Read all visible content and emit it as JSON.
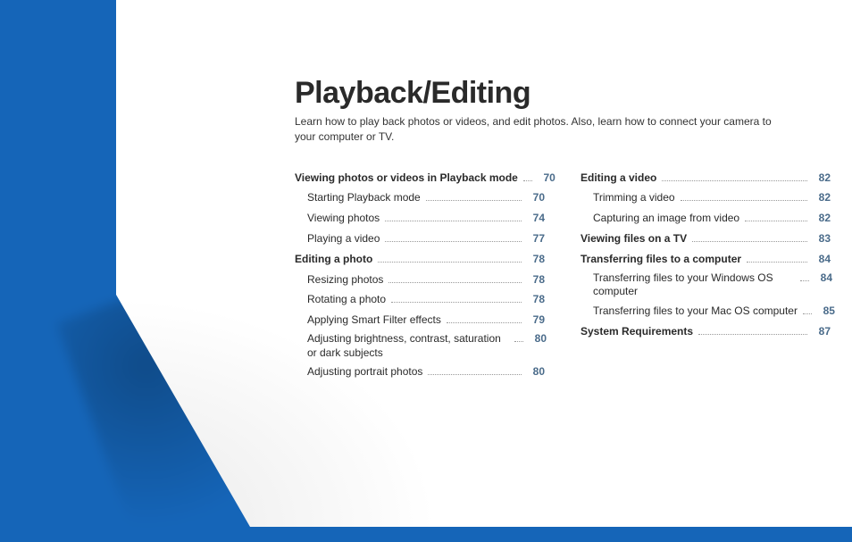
{
  "title": "Playback/Editing",
  "subtitle": "Learn how to play back photos or videos, and edit photos. Also, learn how to connect your camera to your computer or TV.",
  "col1": [
    {
      "label": "Viewing photos or videos in Playback mode",
      "page": "70",
      "type": "section",
      "dots": "…"
    },
    {
      "label": "Starting Playback mode",
      "page": "70",
      "type": "sub"
    },
    {
      "label": "Viewing photos",
      "page": "74",
      "type": "sub"
    },
    {
      "label": "Playing a video",
      "page": "77",
      "type": "sub"
    },
    {
      "label": "Editing a photo",
      "page": "78",
      "type": "section"
    },
    {
      "label": "Resizing photos",
      "page": "78",
      "type": "sub"
    },
    {
      "label": "Rotating a photo",
      "page": "78",
      "type": "sub"
    },
    {
      "label": "Applying Smart Filter effects",
      "page": "79",
      "type": "sub"
    },
    {
      "label": "Adjusting brightness, contrast, saturation or dark subjects",
      "page": "80",
      "type": "wrap"
    },
    {
      "label": "Adjusting portrait photos",
      "page": "80",
      "type": "sub"
    }
  ],
  "col2": [
    {
      "label": "Editing a video",
      "page": "82",
      "type": "section"
    },
    {
      "label": "Trimming a video",
      "page": "82",
      "type": "sub"
    },
    {
      "label": "Capturing an image from video",
      "page": "82",
      "type": "sub"
    },
    {
      "label": "Viewing files on a TV",
      "page": "83",
      "type": "section"
    },
    {
      "label": "Transferring files to a computer",
      "page": "84",
      "type": "section"
    },
    {
      "label": "Transferring files to your Windows OS computer",
      "page": "84",
      "type": "wrap"
    },
    {
      "label": "Transferring files to your Mac OS computer",
      "page": "85",
      "type": "sub"
    },
    {
      "label": "System Requirements",
      "page": "87",
      "type": "section"
    }
  ]
}
